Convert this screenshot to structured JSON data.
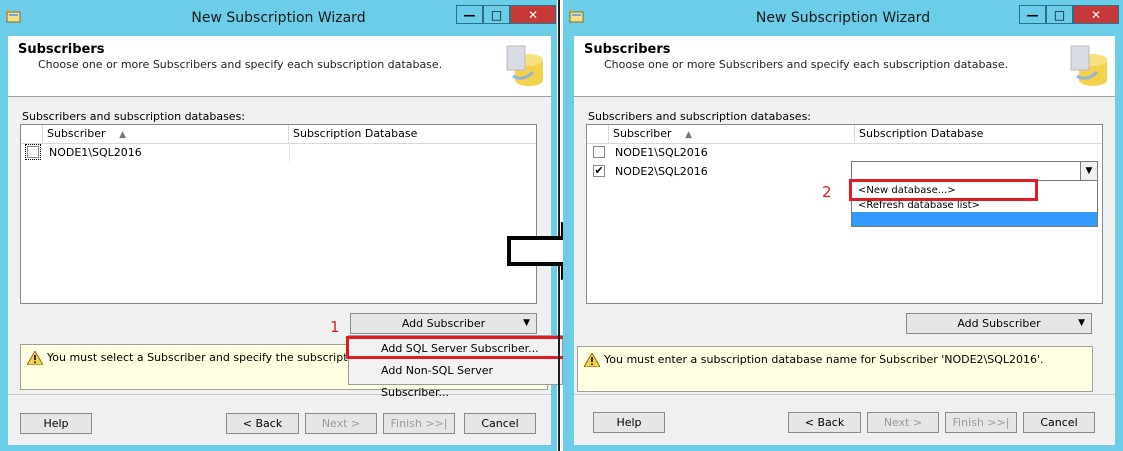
{
  "left": {
    "title": "New Subscription Wizard",
    "header_title": "Subscribers",
    "header_subtitle": "Choose one or more Subscribers and specify each subscription database.",
    "section_label": "Subscribers and subscription databases:",
    "col_subscriber": "Subscriber",
    "col_database": "Subscription Database",
    "rows": [
      {
        "subscriber": "NODE1\\SQL2016",
        "checked": false
      }
    ],
    "add_button": "Add Subscriber",
    "menu": [
      "Add SQL Server Subscriber...",
      "Add Non-SQL Server Subscriber..."
    ],
    "message": "You must select a Subscriber and specify the subscription database.",
    "help": "Help",
    "back": "< Back",
    "next": "Next >",
    "finish": "Finish >>|",
    "cancel": "Cancel",
    "step": "1"
  },
  "right": {
    "title": "New Subscription Wizard",
    "header_title": "Subscribers",
    "header_subtitle": "Choose one or more Subscribers and specify each subscription database.",
    "section_label": "Subscribers and subscription databases:",
    "col_subscriber": "Subscriber",
    "col_database": "Subscription Database",
    "rows": [
      {
        "subscriber": "NODE1\\SQL2016",
        "checked": false,
        "check_mark": ""
      },
      {
        "subscriber": "NODE2\\SQL2016",
        "checked": true,
        "check_mark": "✔"
      }
    ],
    "db_options": [
      "<New database...>",
      "<Refresh database list>"
    ],
    "add_button": "Add Subscriber",
    "message": "You must enter a subscription database name for Subscriber 'NODE2\\SQL2016'.",
    "help": "Help",
    "back": "< Back",
    "next": "Next >",
    "finish": "Finish >>|",
    "cancel": "Cancel",
    "step": "2"
  },
  "icons": {
    "window": "wizard-icon",
    "warning": "warning-icon",
    "header": "database-icon",
    "arrow": "right-arrow-icon"
  },
  "colors": {
    "title_bar": "#6ccde8",
    "close_button": "#c73838",
    "annotation": "#e01b24",
    "highlight": "#3399ff",
    "message_bg": "#ffffe1"
  }
}
